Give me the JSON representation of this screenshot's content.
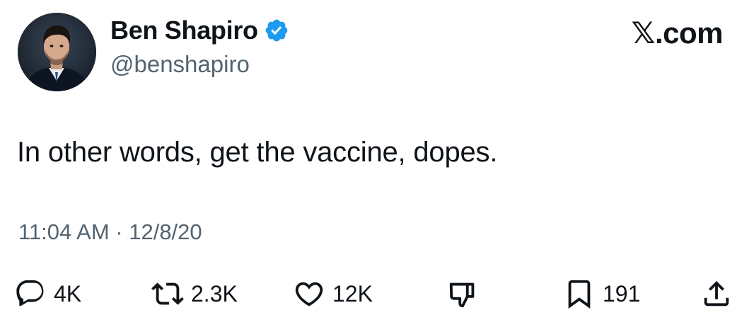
{
  "author": {
    "name": "Ben Shapiro",
    "handle": "@benshapiro",
    "verified": true,
    "verified_color": "#1d9bf0"
  },
  "brand": {
    "label": "X.com",
    "glyph": "𝕏",
    "suffix": ".com"
  },
  "tweet": {
    "text": "In other words, get the vaccine, dopes.",
    "timestamp": "11:04 AM · 12/8/20"
  },
  "actions": {
    "replies": {
      "icon": "reply-icon",
      "count": "4K"
    },
    "reposts": {
      "icon": "repost-icon",
      "count": "2.3K"
    },
    "likes": {
      "icon": "like-icon",
      "count": "12K"
    },
    "downvote": {
      "icon": "downvote-icon"
    },
    "bookmarks": {
      "icon": "bookmark-icon",
      "count": "191"
    },
    "share": {
      "icon": "share-icon"
    }
  },
  "colors": {
    "text": "#0f1419",
    "secondary": "#536471",
    "background": "#ffffff"
  }
}
